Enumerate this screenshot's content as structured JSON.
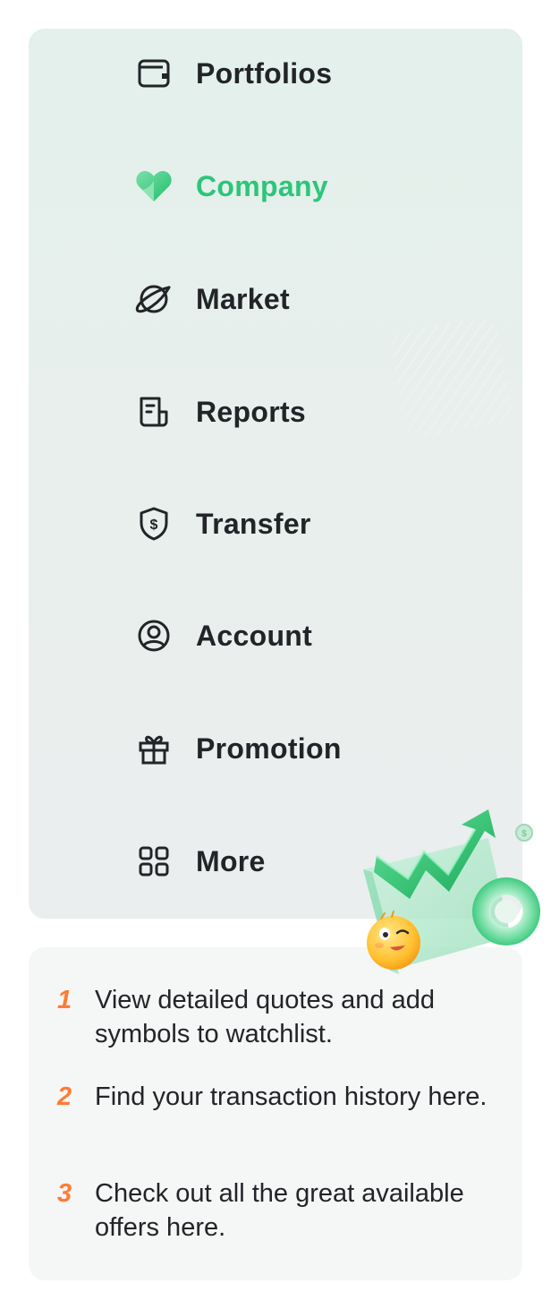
{
  "menu": {
    "items": [
      {
        "id": "portfolios",
        "label": "Portfolios",
        "icon": "wallet-icon",
        "active": false
      },
      {
        "id": "company",
        "label": "Company",
        "icon": "heart-icon",
        "active": true
      },
      {
        "id": "market",
        "label": "Market",
        "icon": "planet-icon",
        "active": false
      },
      {
        "id": "reports",
        "label": "Reports",
        "icon": "report-icon",
        "active": false
      },
      {
        "id": "transfer",
        "label": "Transfer",
        "icon": "shield-dollar-icon",
        "active": false
      },
      {
        "id": "account",
        "label": "Account",
        "icon": "user-circle-icon",
        "active": false
      },
      {
        "id": "promotion",
        "label": "Promotion",
        "icon": "gift-icon",
        "active": false
      },
      {
        "id": "more",
        "label": "More",
        "icon": "grid-icon",
        "active": false
      }
    ],
    "active_color": "#2dc57a",
    "text_color": "#222428"
  },
  "tips": [
    {
      "number": "1",
      "text": "View detailed quotes and add symbols to watchlist."
    },
    {
      "number": "2",
      "text": "Find your transaction history here."
    },
    {
      "number": "3",
      "text": "Check out all the great available offers here."
    }
  ],
  "accent_color": "#ff7b36"
}
